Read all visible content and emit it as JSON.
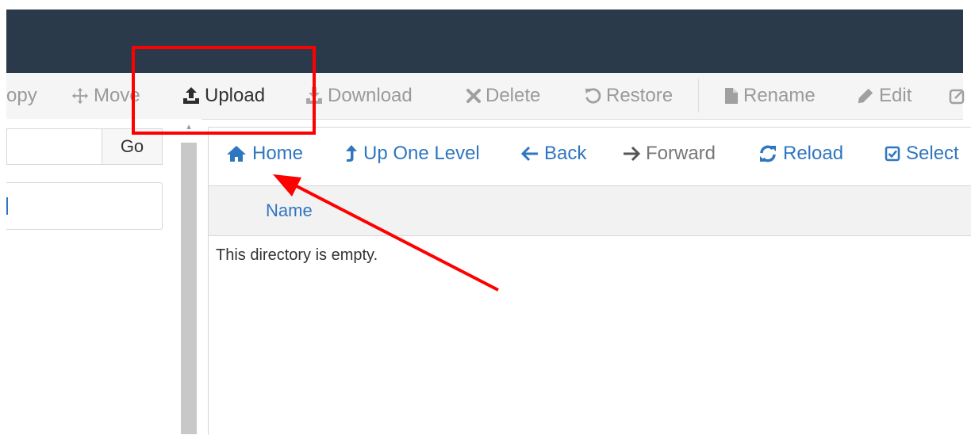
{
  "toolbar": {
    "items": [
      {
        "label": "opy",
        "icon": "copy-icon"
      },
      {
        "label": "Move",
        "icon": "move-icon"
      },
      {
        "label": "Upload",
        "icon": "upload-icon"
      },
      {
        "label": "Download",
        "icon": "download-icon"
      },
      {
        "label": "Delete",
        "icon": "delete-icon"
      },
      {
        "label": "Restore",
        "icon": "restore-icon"
      },
      {
        "label": "Rename",
        "icon": "file-icon"
      },
      {
        "label": "Edit",
        "icon": "pencil-icon"
      }
    ]
  },
  "sidebar": {
    "go_label": "Go"
  },
  "navbar": {
    "items": [
      {
        "label": "Home",
        "icon": "home-icon"
      },
      {
        "label": "Up One Level",
        "icon": "level-up-icon"
      },
      {
        "label": "Back",
        "icon": "arrow-left-icon"
      },
      {
        "label": "Forward",
        "icon": "arrow-right-icon"
      },
      {
        "label": "Reload",
        "icon": "refresh-icon"
      },
      {
        "label": "Select",
        "icon": "checkbox-icon"
      }
    ]
  },
  "table": {
    "columns": [
      "Name"
    ],
    "empty_message": "This directory is empty."
  },
  "colors": {
    "header_bg": "#2b3a4a",
    "link": "#2f76c0",
    "annotation": "#ff0000"
  }
}
